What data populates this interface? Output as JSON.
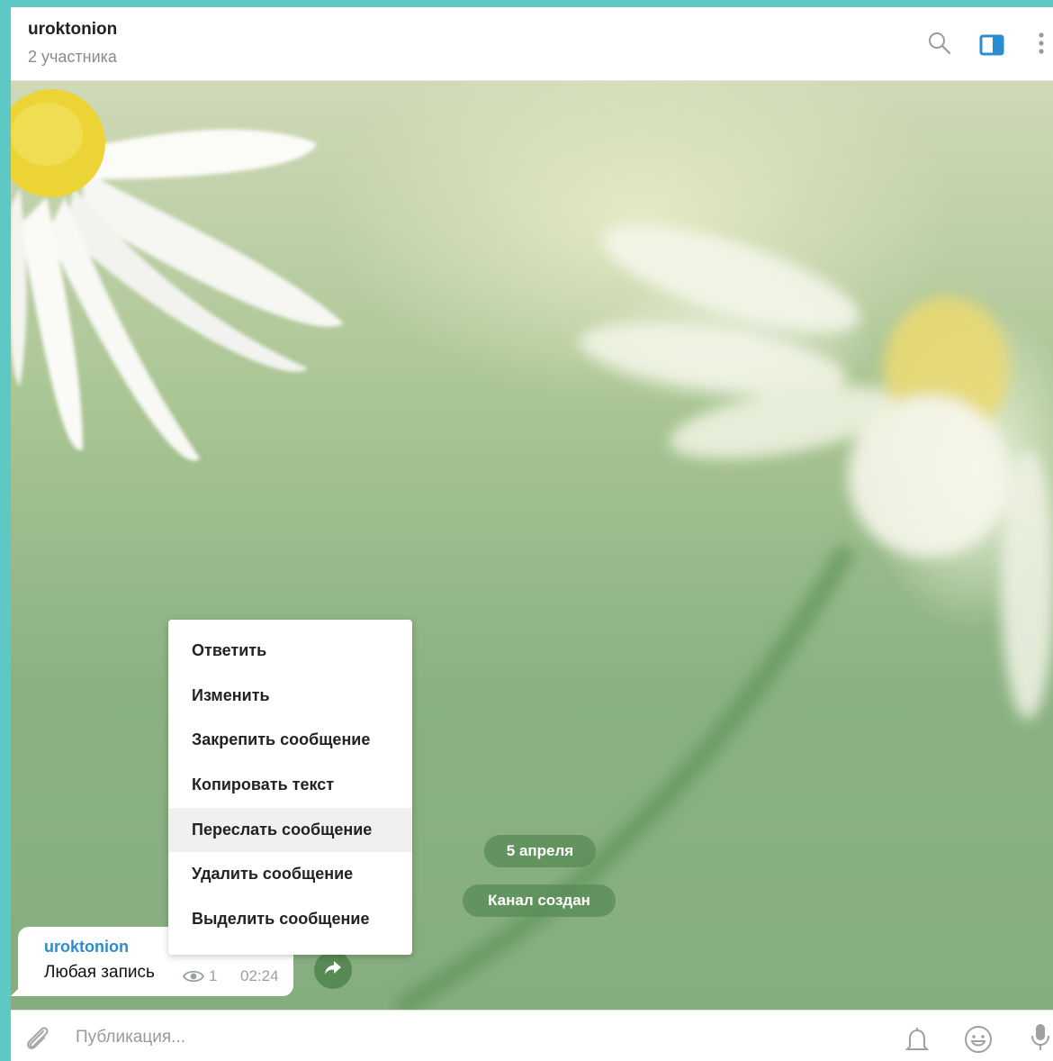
{
  "header": {
    "title": "uroktonion",
    "subtitle": "2 участника",
    "icons": [
      "search-icon",
      "sidebar-panel-icon",
      "more-vertical-icon"
    ],
    "accent_color": "#2a8dd1"
  },
  "chat": {
    "date_label": "5 апреля",
    "service_message": "Канал создан",
    "message": {
      "author": "uroktonion",
      "text": "Любая запись",
      "views": "1",
      "time": "02:24"
    }
  },
  "context_menu": {
    "items": [
      "Ответить",
      "Изменить",
      "Закрепить сообщение",
      "Копировать текст",
      "Переслать сообщение",
      "Удалить сообщение",
      "Выделить сообщение"
    ],
    "highlighted_index": 4
  },
  "composer": {
    "placeholder": "Публикация...",
    "icons": [
      "paperclip-icon",
      "bell-icon",
      "emoji-icon",
      "microphone-icon"
    ]
  }
}
